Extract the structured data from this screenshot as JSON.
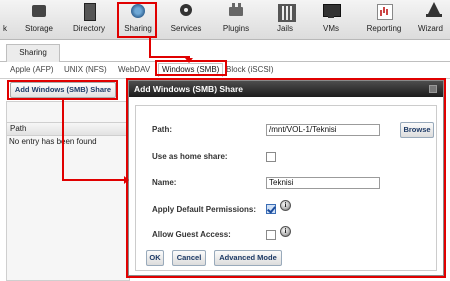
{
  "toolbar": {
    "items": [
      {
        "label": "Storage",
        "icon": "storage-icon"
      },
      {
        "label": "Directory",
        "icon": "directory-icon"
      },
      {
        "label": "Sharing",
        "icon": "sharing-icon"
      },
      {
        "label": "Services",
        "icon": "services-icon"
      },
      {
        "label": "Plugins",
        "icon": "plugins-icon"
      },
      {
        "label": "Jails",
        "icon": "jails-icon"
      },
      {
        "label": "VMs",
        "icon": "vms-icon"
      },
      {
        "label": "Reporting",
        "icon": "reporting-icon"
      },
      {
        "label": "Wizard",
        "icon": "wizard-icon"
      }
    ],
    "left_fragment": "k"
  },
  "panel": {
    "tab_label": "Sharing",
    "subtabs": [
      "Apple (AFP)",
      "UNIX (NFS)",
      "WebDAV",
      "Windows (SMB)",
      "Block (iSCSI)"
    ],
    "active_subtab": "Windows (SMB)"
  },
  "add_button": {
    "label": "Add Windows (SMB) Share"
  },
  "grid": {
    "header": "Path",
    "empty_message": "No entry has been found"
  },
  "modal": {
    "title": "Add Windows (SMB) Share",
    "fields": {
      "path": {
        "label": "Path:",
        "value": "/mnt/VOL-1/Teknisi",
        "browse_label": "Browse"
      },
      "home_share": {
        "label": "Use as home share:",
        "checked": false
      },
      "name": {
        "label": "Name:",
        "value": "Teknisi"
      },
      "default_permissions": {
        "label": "Apply Default Permissions:",
        "checked": true
      },
      "guest_access": {
        "label": "Allow Guest Access:",
        "checked": false
      }
    },
    "info_glyph": "i",
    "buttons": {
      "ok": "OK",
      "cancel": "Cancel",
      "advanced": "Advanced Mode"
    }
  },
  "colors": {
    "annotation": "#e00000",
    "title_bar": "#2b2b2b",
    "button_text": "#1d3a66"
  }
}
